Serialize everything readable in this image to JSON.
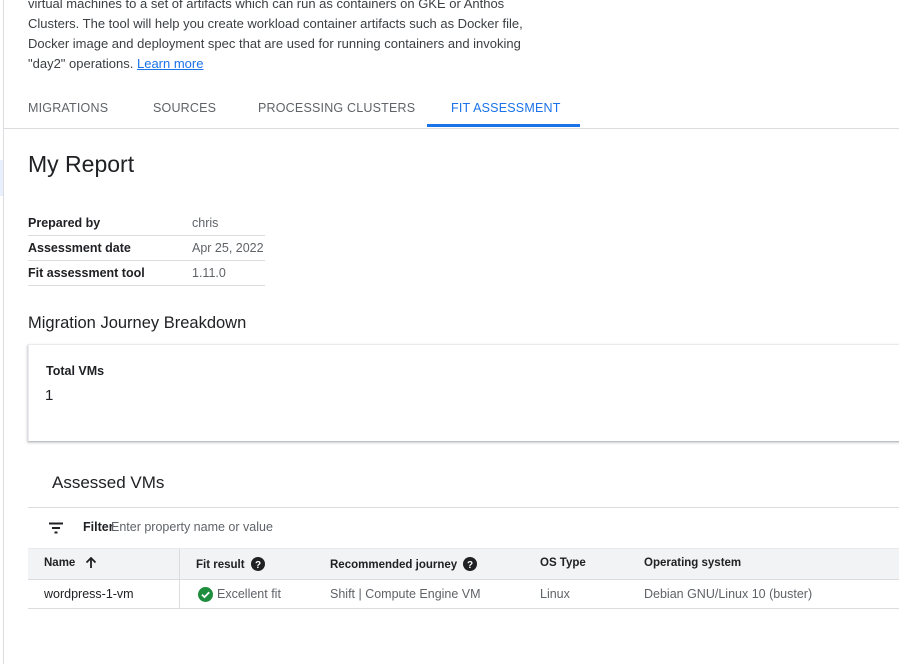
{
  "intro": {
    "line1": "virtual machines to a set of artifacts which can run as containers on GKE or Anthos",
    "line2": "Clusters. The tool will help you create workload container artifacts such as Docker file,",
    "line3": "Docker image and deployment spec that are used for running containers and invoking",
    "line4": "\"day2\" operations.",
    "link": "Learn more"
  },
  "tabs": [
    {
      "label": "MIGRATIONS"
    },
    {
      "label": "SOURCES"
    },
    {
      "label": "PROCESSING CLUSTERS"
    },
    {
      "label": "FIT ASSESSMENT",
      "active": true
    }
  ],
  "report": {
    "title": "My Report",
    "meta": [
      {
        "key": "Prepared by",
        "value": "chris"
      },
      {
        "key": "Assessment date",
        "value": "Apr 25, 2022"
      },
      {
        "key": "Fit assessment tool",
        "value": "1.11.0"
      }
    ]
  },
  "breakdown": {
    "title": "Migration Journey Breakdown",
    "total_label": "Total VMs",
    "total_value": "1"
  },
  "assessed": {
    "title": "Assessed VMs",
    "filter_label": "Filter",
    "filter_placeholder": "Enter property name or value",
    "columns": [
      "Name",
      "Fit result",
      "Recommended journey",
      "OS Type",
      "Operating system"
    ],
    "rows": [
      {
        "name": "wordpress-1-vm",
        "fit_result": "Excellent fit",
        "journey": "Shift | Compute Engine VM",
        "os_type": "Linux",
        "os": "Debian GNU/Linux 10 (buster)"
      }
    ]
  },
  "icons": {
    "filter": "filter-icon",
    "sort": "arrow-up-icon",
    "help": "help-circle-icon",
    "fit_ok": "check-circle-icon"
  },
  "colors": {
    "accent": "#1a73e8",
    "success": "#1e8e3e",
    "text": "#202124",
    "muted": "#5f6368"
  }
}
